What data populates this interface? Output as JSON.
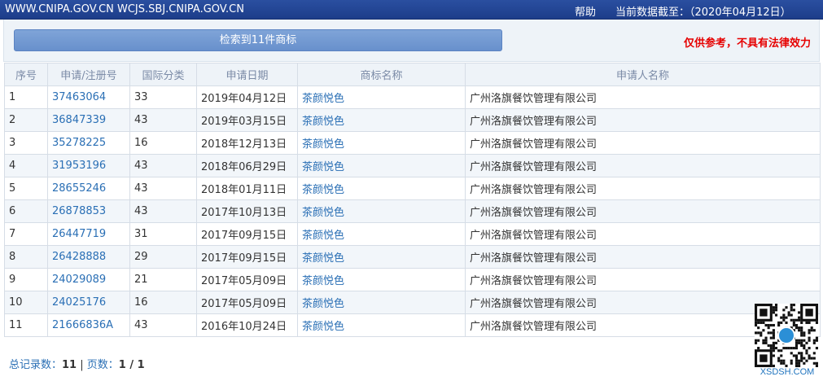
{
  "topbar": {
    "domains": "WWW.CNIPA.GOV.CN WCJS.SBJ.CNIPA.GOV.CN",
    "help": "帮助",
    "as_of": "当前数据截至：（2020年04月12日）"
  },
  "search": {
    "result_button": "检索到11件商标",
    "disclaimer": "仅供参考，不具有法律效力"
  },
  "table": {
    "headers": [
      "序号",
      "申请/注册号",
      "国际分类",
      "申请日期",
      "商标名称",
      "申请人名称"
    ],
    "rows": [
      {
        "no": "1",
        "reg": "37463064",
        "cls": "33",
        "date": "2019年04月12日",
        "name": "茶颜悦色",
        "applicant": "广州洛旗餐饮管理有限公司"
      },
      {
        "no": "2",
        "reg": "36847339",
        "cls": "43",
        "date": "2019年03月15日",
        "name": "茶颜悦色",
        "applicant": "广州洛旗餐饮管理有限公司"
      },
      {
        "no": "3",
        "reg": "35278225",
        "cls": "16",
        "date": "2018年12月13日",
        "name": "茶颜悦色",
        "applicant": "广州洛旗餐饮管理有限公司"
      },
      {
        "no": "4",
        "reg": "31953196",
        "cls": "43",
        "date": "2018年06月29日",
        "name": "茶颜悦色",
        "applicant": "广州洛旗餐饮管理有限公司"
      },
      {
        "no": "5",
        "reg": "28655246",
        "cls": "43",
        "date": "2018年01月11日",
        "name": "茶颜悦色",
        "applicant": "广州洛旗餐饮管理有限公司"
      },
      {
        "no": "6",
        "reg": "26878853",
        "cls": "43",
        "date": "2017年10月13日",
        "name": "茶颜悦色",
        "applicant": "广州洛旗餐饮管理有限公司"
      },
      {
        "no": "7",
        "reg": "26447719",
        "cls": "31",
        "date": "2017年09月15日",
        "name": "茶颜悦色",
        "applicant": "广州洛旗餐饮管理有限公司"
      },
      {
        "no": "8",
        "reg": "26428888",
        "cls": "29",
        "date": "2017年09月15日",
        "name": "茶颜悦色",
        "applicant": "广州洛旗餐饮管理有限公司"
      },
      {
        "no": "9",
        "reg": "24029089",
        "cls": "21",
        "date": "2017年05月09日",
        "name": "茶颜悦色",
        "applicant": "广州洛旗餐饮管理有限公司"
      },
      {
        "no": "10",
        "reg": "24025176",
        "cls": "16",
        "date": "2017年05月09日",
        "name": "茶颜悦色",
        "applicant": "广州洛旗餐饮管理有限公司"
      },
      {
        "no": "11",
        "reg": "21666836A",
        "cls": "43",
        "date": "2016年10月24日",
        "name": "茶颜悦色",
        "applicant": "广州洛旗餐饮管理有限公司"
      }
    ]
  },
  "summary": {
    "total_label": "总记录数：",
    "total_value": "11",
    "separator": "|",
    "pages_label": "页数：",
    "pages_value": "1 / 1"
  },
  "watermark": {
    "icon": "qr-code-icon",
    "text": "XSDSH.COM"
  }
}
